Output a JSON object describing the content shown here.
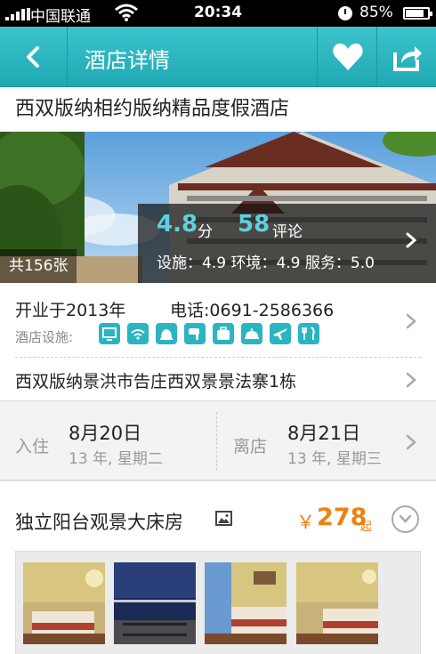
{
  "status_bar": {
    "carrier": "中国联通",
    "time": "20:34",
    "battery": "85%",
    "battery_level": 0.85
  },
  "nav": {
    "title": "酒店详情",
    "back_icon": "chevron-left-icon",
    "favorite_icon": "heart-icon",
    "share_icon": "share-icon"
  },
  "hotel": {
    "name": "西双版纳相约版纳精品度假酒店",
    "photo_count": "共156张",
    "rating": {
      "score": "4.8",
      "score_unit": "分",
      "reviews": "58",
      "reviews_unit": "评论",
      "subscores": "设施：4.9 环境：4.9 服务：5.0"
    },
    "opened": "开业于2013年",
    "phone": "电话:0691-2586366",
    "facilities_label": "酒店设施:",
    "facility_icons": [
      "tv-icon",
      "wifi-icon",
      "bell-icon",
      "hairdryer-icon",
      "luggage-icon",
      "room-service-icon",
      "airplane-icon",
      "restaurant-icon"
    ],
    "address": "西双版纳景洪市告庄西双景景法寨1栋"
  },
  "dates": {
    "checkin_label": "入住",
    "checkin_date": "8月20日",
    "checkin_week": "13 年, 星期二",
    "checkout_label": "离店",
    "checkout_date": "8月21日",
    "checkout_week": "13 年, 星期三"
  },
  "room": {
    "name": "独立阳台观景大床房",
    "price_symbol": "￥",
    "price": "278",
    "price_unit": "起"
  },
  "colors": {
    "accent": "#2ab5c0",
    "price": "#f08010",
    "score": "#5cd1de"
  }
}
